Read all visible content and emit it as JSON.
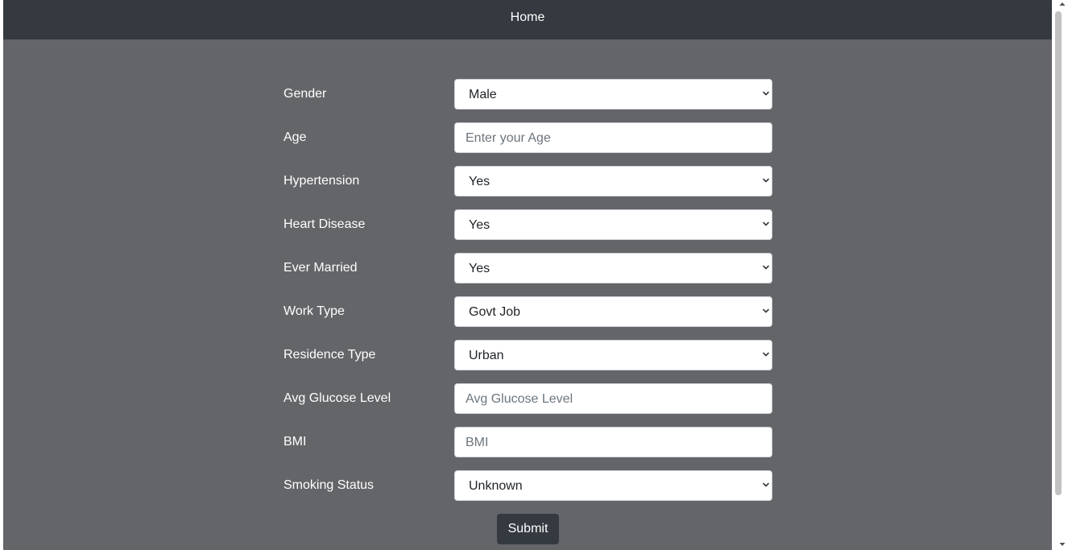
{
  "navbar": {
    "home_label": "Home"
  },
  "form": {
    "gender": {
      "label": "Gender",
      "value": "Male"
    },
    "age": {
      "label": "Age",
      "placeholder": "Enter your Age"
    },
    "hypertension": {
      "label": "Hypertension",
      "value": "Yes"
    },
    "heart_disease": {
      "label": "Heart Disease",
      "value": "Yes"
    },
    "ever_married": {
      "label": "Ever Married",
      "value": "Yes"
    },
    "work_type": {
      "label": "Work Type",
      "value": "Govt Job"
    },
    "residence": {
      "label": "Residence Type",
      "value": "Urban"
    },
    "glucose": {
      "label": "Avg Glucose Level",
      "placeholder": "Avg Glucose Level"
    },
    "bmi": {
      "label": "BMI",
      "placeholder": "BMI"
    },
    "smoking": {
      "label": "Smoking Status",
      "value": "Unknown"
    },
    "submit_label": "Submit"
  },
  "colors": {
    "navbar_bg": "#343a40",
    "page_bg": "#646569",
    "button_bg": "#343a40",
    "placeholder": "#6c757d"
  }
}
